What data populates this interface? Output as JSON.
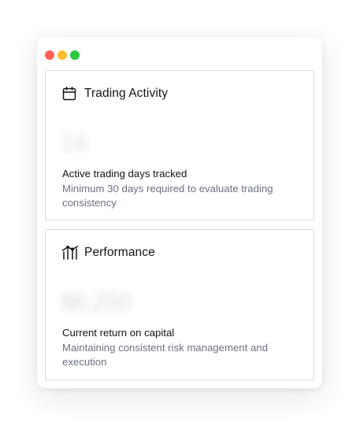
{
  "window": {
    "controls": {
      "close_color": "#ff5f57",
      "minimize_color": "#febc2e",
      "zoom_color": "#28c840"
    }
  },
  "cards": [
    {
      "icon": "calendar-icon",
      "title": "Trading Activity",
      "value": "14",
      "label": "Active trading days tracked",
      "description": "Minimum 30 days required to evaluate trading consistency"
    },
    {
      "icon": "line-chart-icon",
      "title": "Performance",
      "value": "$6,250",
      "label": "Current return on capital",
      "description": "Maintaining consistent risk management and execution"
    }
  ]
}
